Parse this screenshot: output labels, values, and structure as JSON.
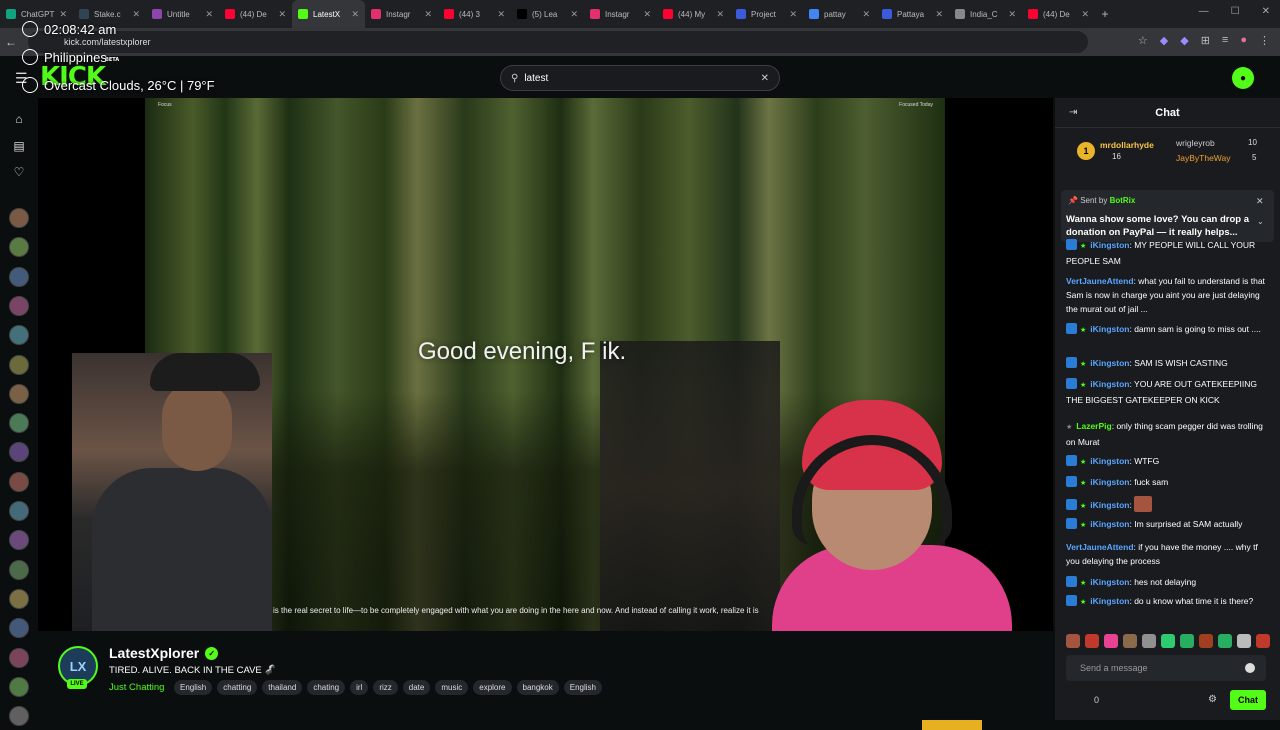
{
  "browser": {
    "tabs": [
      {
        "label": "ChatGPT",
        "color": "#10a37f"
      },
      {
        "label": "Stake.c",
        "color": "#2f4553"
      },
      {
        "label": "Untitle",
        "color": "#8e44ad"
      },
      {
        "label": "(44) De",
        "color": "#ff0033"
      },
      {
        "label": "LatestX",
        "color": "#53fc18",
        "active": true
      },
      {
        "label": "Instagr",
        "color": "#e1306c"
      },
      {
        "label": "(44) 3",
        "color": "#ff0033"
      },
      {
        "label": "(5) Lea",
        "color": "#000000"
      },
      {
        "label": "Instagr",
        "color": "#e1306c"
      },
      {
        "label": "(44) My",
        "color": "#ff0033"
      },
      {
        "label": "Project",
        "color": "#3b5bdb"
      },
      {
        "label": "pattay",
        "color": "#4285f4"
      },
      {
        "label": "Pattaya",
        "color": "#3b5bdb"
      },
      {
        "label": "India_C",
        "color": "#888888"
      },
      {
        "label": "(44) De",
        "color": "#ff0033"
      }
    ],
    "url": "kick.com/latestxplorer"
  },
  "overlay": {
    "clock": "02:08:42 am",
    "location": "Philippines",
    "weather": "Overcast Clouds, 26°C | 79°F"
  },
  "header": {
    "logo": "KICK",
    "logo_beta": "BETA",
    "search_value": "latest"
  },
  "video": {
    "label_left": "Focus",
    "label_right": "Focused Today",
    "greeting": "Good evening, F    ik.",
    "quote": "is the real secret to life—to be completely engaged with what you are doing in the here and now. And instead of calling it work, realize it is"
  },
  "streamer": {
    "name": "LatestXplorer",
    "initials": "LX",
    "live": "LIVE",
    "title": "TIRED. ALIVE. BACK IN THE CAVE 🦨",
    "category": "Just Chatting",
    "tags": [
      "English",
      "chatting",
      "thailand",
      "chating",
      "irl",
      "rizz",
      "date",
      "music",
      "explore",
      "bangkok",
      "English"
    ]
  },
  "chat": {
    "title": "Chat",
    "leaderboard": [
      {
        "name": "mrdollarhyde",
        "count": "16",
        "color": "#f5c542"
      },
      {
        "name": "wrigleyrob",
        "count": "10",
        "color": "#cccccc"
      },
      {
        "name": "JayByTheWay",
        "count": "5",
        "color": "#f0a030"
      }
    ],
    "pinned": {
      "sent_by": "Sent by",
      "bot": "BotRix",
      "message": "Wanna show some love? You can drop a donation on PayPal — it really helps..."
    },
    "messages": [
      {
        "user": "iKingston",
        "text": ": MY PEOPLE WILL CALL YOUR PEOPLE SAM",
        "badges": true
      },
      {
        "user": "VertJauneAttend",
        "text": ": what you fail to understand is that Sam is now in charge you aint you are just delaying the murat out of jail ...",
        "badges": false
      },
      {
        "user": "iKingston",
        "text": ": damn sam is going to miss out ....",
        "badges": true
      },
      {
        "user": "iKingston",
        "text": ": SAM IS WISH CASTING",
        "badges": true
      },
      {
        "user": "iKingston",
        "text": ": YOU ARE OUT GATEKEEPIING THE BIGGEST GATEKEEPER ON KICK",
        "badges": true
      },
      {
        "user": "LazerPig",
        "text": ": only thing scam pegger did was trolling on Murat",
        "badges": false,
        "green": true
      },
      {
        "user": "iKingston",
        "text": ": WTFG",
        "badges": true
      },
      {
        "user": "iKingston",
        "text": ": fuck sam",
        "badges": true
      },
      {
        "user": "iKingston",
        "text": ":",
        "badges": true,
        "emote": true
      },
      {
        "user": "iKingston",
        "text": ": Im surprised at SAM actually",
        "badges": true
      },
      {
        "user": "VertJauneAttend",
        "text": ": if you have the money .... why tf you delaying the process",
        "badges": false
      },
      {
        "user": "iKingston",
        "text": ": hes not delaying",
        "badges": true
      },
      {
        "user": "iKingston",
        "text": ": do u know what time it is there?",
        "badges": true
      }
    ],
    "input_placeholder": "Send a message",
    "send_label": "Chat",
    "count": "0"
  }
}
